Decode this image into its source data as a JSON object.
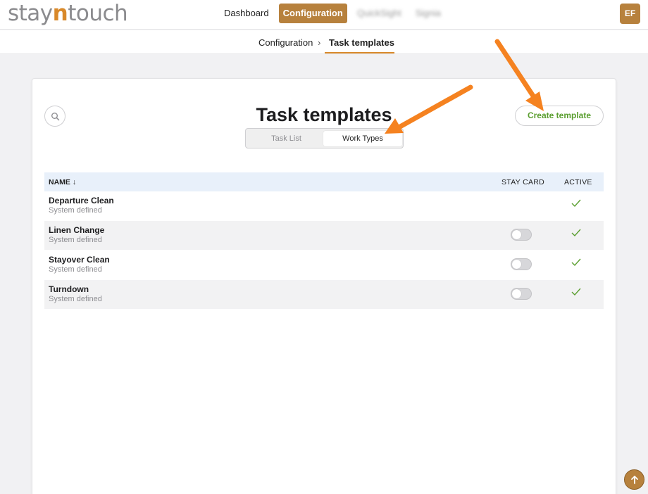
{
  "brand": {
    "logo_prefix": "stay",
    "logo_accent": "n",
    "logo_suffix": "touch"
  },
  "nav": {
    "items": [
      {
        "label": "Dashboard",
        "active": false
      },
      {
        "label": "Configuration",
        "active": true
      },
      {
        "label": "QuickSight",
        "active": false
      },
      {
        "label": "Signia",
        "active": false
      }
    ]
  },
  "user": {
    "initials": "EF"
  },
  "breadcrumb": {
    "parent": "Configuration",
    "separator": "›",
    "current": "Task templates"
  },
  "page": {
    "title": "Task templates",
    "create_button": "Create template",
    "tabs": [
      {
        "label": "Task List",
        "selected": false
      },
      {
        "label": "Work Types",
        "selected": true
      }
    ]
  },
  "table": {
    "columns": {
      "name": "NAME ↓",
      "stay_card": "STAY CARD",
      "active": "ACTIVE"
    },
    "rows": [
      {
        "name": "Departure Clean",
        "subtitle": "System defined",
        "stay_card_toggle": false,
        "stay_card_shown": false,
        "active": true
      },
      {
        "name": "Linen Change",
        "subtitle": "System defined",
        "stay_card_toggle": false,
        "stay_card_shown": true,
        "active": true
      },
      {
        "name": "Stayover Clean",
        "subtitle": "System defined",
        "stay_card_toggle": false,
        "stay_card_shown": true,
        "active": true
      },
      {
        "name": "Turndown",
        "subtitle": "System defined",
        "stay_card_toggle": false,
        "stay_card_shown": true,
        "active": true
      }
    ]
  },
  "colors": {
    "brand": "#b7813d",
    "accent": "#d9892a",
    "success": "#5a9e2f",
    "annotation_arrow": "#f58220"
  }
}
